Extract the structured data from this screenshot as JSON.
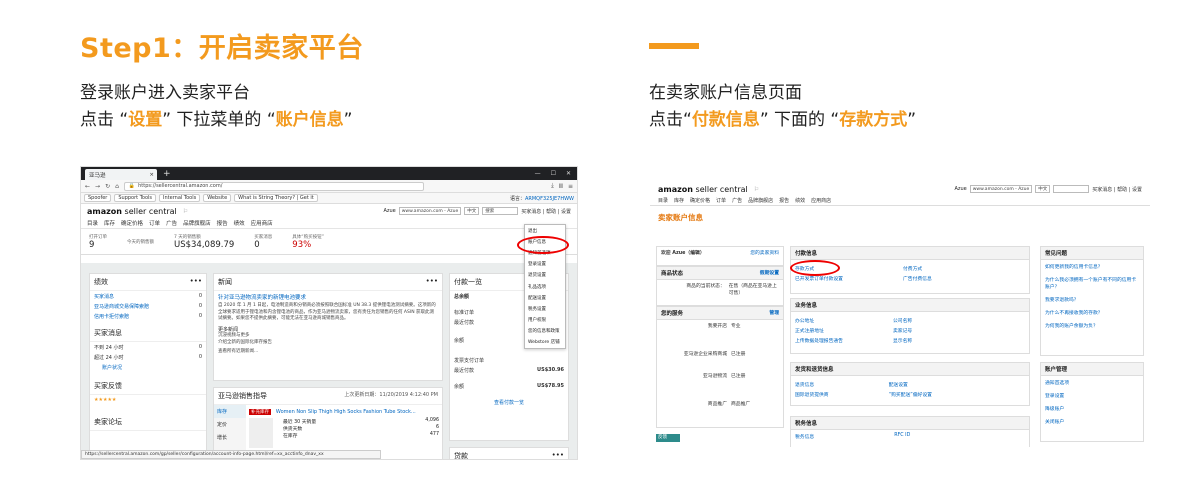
{
  "step": {
    "title": "Step1：开启卖家平台"
  },
  "left_instructions": {
    "line1": "登录账户进入卖家平台",
    "line2_prefix": "点击 “",
    "line2_hl1": "设置",
    "line2_mid": "” 下拉菜单的 “",
    "line2_hl2": "账户信息",
    "line2_suffix": "”"
  },
  "right_instructions": {
    "line1": "在卖家账户信息页面",
    "line2_prefix": "点击“",
    "line2_hl1": "付款信息",
    "line2_mid": "” 下面的 “",
    "line2_hl2": "存款方式",
    "line2_suffix": "”"
  },
  "colors": {
    "accent": "#f39a1e",
    "highlight_ring": "#ee0000",
    "link": "#0066c0"
  },
  "browser": {
    "tab_label": "亚马逊",
    "tab_add": "+",
    "url": "https://sellercentral.amazon.com/",
    "bookmarks": [
      "Spoofer",
      "Support Tools",
      "Internal Tools",
      "Website",
      "What is String Theory? | Get it"
    ],
    "bookmarks_right": "语言：",
    "bookmarks_right_link": "ARMQF325JE7HWW",
    "status_url": "https://sellercentral.amazon.com/gp/seller/configuration/account-info-page.html/ref=xx_acctinfo_dnav_xx"
  },
  "seller_central": {
    "logo_main": "amazon",
    "logo_sub": " seller central",
    "account_name": "Azue",
    "marketplace": "www.amazon.com - Azue",
    "language": "中文",
    "search_placeholder": "搜索",
    "top_links": "买家消息 | 帮助 | 设置",
    "nav": [
      "目录",
      "库存",
      "确定价格",
      "订单",
      "广告",
      "品牌旗舰店",
      "报告",
      "绩效",
      "应用商店"
    ],
    "metrics": [
      {
        "label": "打开订单",
        "value": "9"
      },
      {
        "label": "今天的销售额",
        "value": ""
      },
      {
        "label": "7 天的销售额",
        "value": "US$34,089.79"
      },
      {
        "label": "买家消息",
        "value": "0"
      },
      {
        "label": "具体“购买按钮”",
        "value": "93%"
      }
    ],
    "settings_menu": [
      "退出",
      "账户信息",
      "通知首选项",
      "登录设置",
      "退货设置",
      "礼品选项",
      "配送设置",
      "税务设置",
      "用户权限",
      "您的信息和政策",
      "Webstore 店铺"
    ],
    "performance_card": {
      "title": "绩效",
      "rows": [
        "买家消息",
        "亚马逊商城交易保障索赔",
        "信用卡拒付索赔"
      ],
      "counts": [
        "0",
        "0",
        "0"
      ],
      "messages_title": "买家消息",
      "messages_rows": [
        {
          "label": "不到 24 小时",
          "value": "0"
        },
        {
          "label": "超过 24 小时",
          "value": "0"
        }
      ],
      "reply_link": "账户状况",
      "feedback_title": "买家反馈",
      "forum_title": "卖家论坛"
    },
    "news_card": {
      "title": "新闻",
      "headline": "针对亚马逊物流卖家的新锂电池要求",
      "body": "自 2020 年 1 月 1 日起，电池制造商和分销商必须按照联合国标准 UN 38.3 提供锂电池测试摘要。这项新的全球要求适用于锂电池和内含锂电池的商品，作为亚马逊物流卖家，您有责任为您销售的任何 ASIN 获取此测试摘要。如果您不提供此摘要，可能无法在亚马逊商城销售商品。",
      "more_title": "更多新闻",
      "more_links": [
        "沉浸视频与更多",
        "介绍全新的国际化库存报告"
      ],
      "all_news": "查看所有近期新闻..."
    },
    "payments_card": {
      "title": "付款一览",
      "summary": "总余额",
      "std_orders": "标准订单",
      "recent_payment": "最近付款",
      "balance": "余额",
      "invoiced_orders": "发票支付订单",
      "recent_payment_2": "最近付款",
      "amount_1": "US$30.96",
      "balance_2": "余额",
      "amount_2": "US$78.95",
      "view_link": "查看付款一览"
    },
    "selling_card": {
      "title": "亚马逊销售指导",
      "date_label": "上次更新日期：",
      "date_value": "11/20/2019 4:12:40 PM",
      "tabs": [
        "库存",
        "定价",
        "增长"
      ],
      "product_title": "Women Non Slip Thigh High Socks Fashion Tube Stock...",
      "badge": "补充库存",
      "metrics": [
        {
          "label": "最近 30 天销量",
          "value": "4,096"
        },
        {
          "label": "供货天数",
          "value": "6"
        },
        {
          "label": "在库存",
          "value": "477"
        }
      ]
    },
    "loans_card": {
      "title": "贷款"
    }
  },
  "account_page": {
    "logo_main": "amazon",
    "logo_sub": " seller central",
    "account_name": "Azue",
    "marketplace": "www.amazon.com - Azue",
    "language": "中文",
    "top_links": "买家消息 | 帮助 | 设置",
    "nav": [
      "目录",
      "库存",
      "确定价格",
      "订单",
      "广告",
      "品牌旗舰店",
      "报告",
      "绩效",
      "应用商店"
    ],
    "title": "卖家账户信息",
    "welcome": "欢迎 Azue（编辑）",
    "seller_home": "您的卖家资料",
    "listing_status": {
      "header": "商品状态",
      "header_link": "假期设置",
      "label": "商品的当前状态：",
      "value": "在售（商品在亚马逊上可售）"
    },
    "your_services": {
      "header": "您的服务",
      "header_link": "管理",
      "rows": [
        {
          "k": "我要开店",
          "v": "专业"
        },
        {
          "k": "亚马逊企业采购商城",
          "v": "已注册"
        },
        {
          "k": "亚马逊物流",
          "v": "已注册"
        },
        {
          "k": "商品推广",
          "v": "商品推广"
        }
      ]
    },
    "payment_info": {
      "header": "付款信息",
      "left_links": [
        "存款方式",
        "已开发票订单付款设置"
      ],
      "right_links": [
        "付费方式",
        "广告付费信息"
      ]
    },
    "business_info": {
      "header": "业务信息",
      "left_links": [
        "办公地址",
        "正式注册地址",
        "上传数据处理报告通告"
      ],
      "right_links": [
        "公司名称",
        "卖家记号",
        "显示名称"
      ]
    },
    "shipping_info": {
      "header": "发货和退货信息",
      "left_links": [
        "退货信息",
        "国际退货提供商"
      ],
      "right_links": [
        "配送设置",
        "“购买配送”偏好设置"
      ]
    },
    "tax_info": {
      "header": "税务信息",
      "left_links": [
        "税务信息"
      ],
      "right_links": [
        "RFC ID"
      ]
    },
    "faq": {
      "header": "常见问题",
      "links": [
        "如何更新我的信用卡信息？",
        "为什么我必须拥有一个账户有不同的信用卡账户？",
        "我要求退款吗？",
        "为什么不再接收我的存款？",
        "为何我的账户余额为负？"
      ]
    },
    "account_mgmt": {
      "header": "账户管理",
      "links": [
        "通知首选项",
        "登录设置",
        "降级账户",
        "关闭账户"
      ]
    },
    "feedback_button": "反馈"
  }
}
